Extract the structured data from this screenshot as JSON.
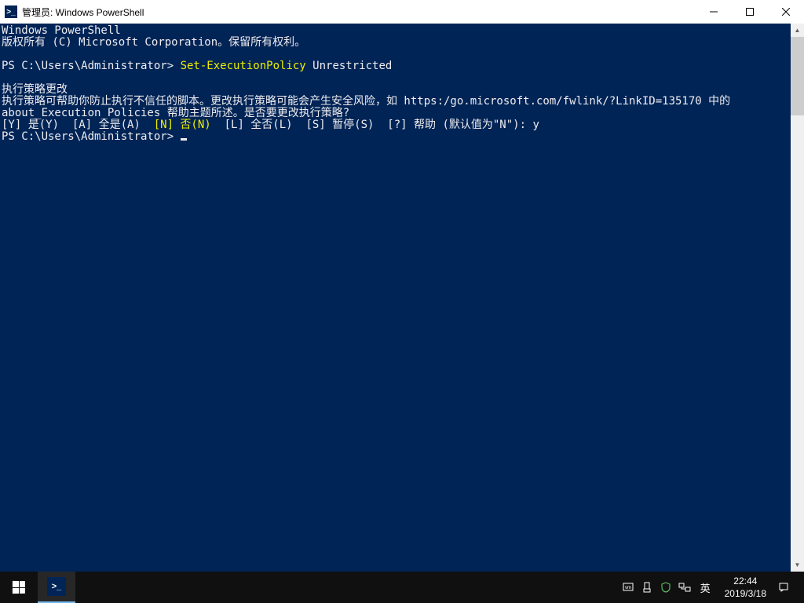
{
  "window": {
    "title": "管理员: Windows PowerShell",
    "icon_text": ">_"
  },
  "console": {
    "header1": "Windows PowerShell",
    "header2": "版权所有 (C) Microsoft Corporation。保留所有权利。",
    "prompt1": "PS C:\\Users\\Administrator> ",
    "cmd_part1": "Set-ExecutionPolicy",
    "cmd_part2": " Unrestricted",
    "policy_title": "执行策略更改",
    "policy_line1": "执行策略可帮助你防止执行不信任的脚本。更改执行策略可能会产生安全风险，如 https:/go.microsoft.com/fwlink/?LinkID=135170 中的",
    "policy_line2": "about_Execution_Policies 帮助主题所述。是否要更改执行策略?",
    "opt_y": "[Y] 是(Y)  [A] 全是(A)  ",
    "opt_n": "[N] 否(N)",
    "opt_rest": "  [L] 全否(L)  [S] 暂停(S)  [?] 帮助 (默认值为\"N\"): y",
    "prompt2": "PS C:\\Users\\Administrator> "
  },
  "taskbar": {
    "ps_icon_text": ">_",
    "ime": "英",
    "time": "22:44",
    "date": "2019/3/18"
  }
}
